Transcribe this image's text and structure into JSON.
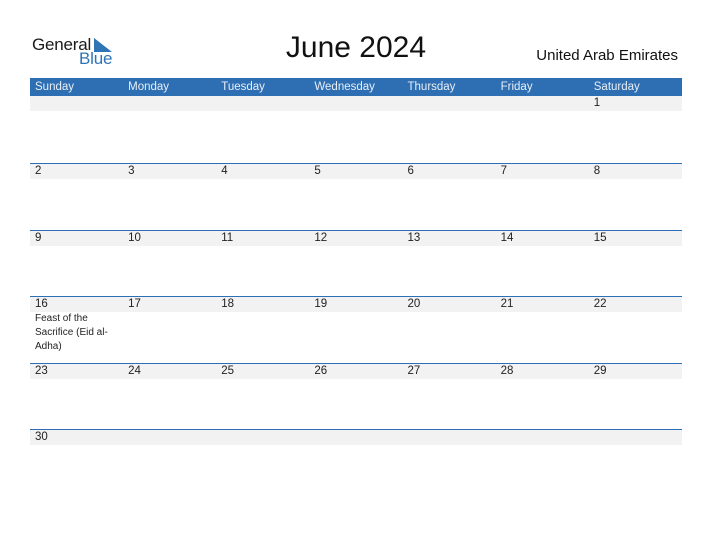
{
  "logo": {
    "text_top": "General",
    "text_bottom": "Blue",
    "brand_color": "#2e75b6",
    "icon": "triangle-flag-icon"
  },
  "title": "June 2024",
  "country": "United Arab Emirates",
  "colors": {
    "header_bg": "#2e6fb3",
    "date_band": "#f2f2f2"
  },
  "weekdays": [
    "Sunday",
    "Monday",
    "Tuesday",
    "Wednesday",
    "Thursday",
    "Friday",
    "Saturday"
  ],
  "weeks": [
    [
      {
        "day": ""
      },
      {
        "day": ""
      },
      {
        "day": ""
      },
      {
        "day": ""
      },
      {
        "day": ""
      },
      {
        "day": ""
      },
      {
        "day": "1"
      }
    ],
    [
      {
        "day": "2"
      },
      {
        "day": "3"
      },
      {
        "day": "4"
      },
      {
        "day": "5"
      },
      {
        "day": "6"
      },
      {
        "day": "7"
      },
      {
        "day": "8"
      }
    ],
    [
      {
        "day": "9"
      },
      {
        "day": "10"
      },
      {
        "day": "11"
      },
      {
        "day": "12"
      },
      {
        "day": "13"
      },
      {
        "day": "14"
      },
      {
        "day": "15"
      }
    ],
    [
      {
        "day": "16",
        "event": "Feast of the Sacrifice (Eid al-Adha)"
      },
      {
        "day": "17"
      },
      {
        "day": "18"
      },
      {
        "day": "19"
      },
      {
        "day": "20"
      },
      {
        "day": "21"
      },
      {
        "day": "22"
      }
    ],
    [
      {
        "day": "23"
      },
      {
        "day": "24"
      },
      {
        "day": "25"
      },
      {
        "day": "26"
      },
      {
        "day": "27"
      },
      {
        "day": "28"
      },
      {
        "day": "29"
      }
    ],
    [
      {
        "day": "30"
      },
      {
        "day": ""
      },
      {
        "day": ""
      },
      {
        "day": ""
      },
      {
        "day": ""
      },
      {
        "day": ""
      },
      {
        "day": ""
      }
    ]
  ]
}
